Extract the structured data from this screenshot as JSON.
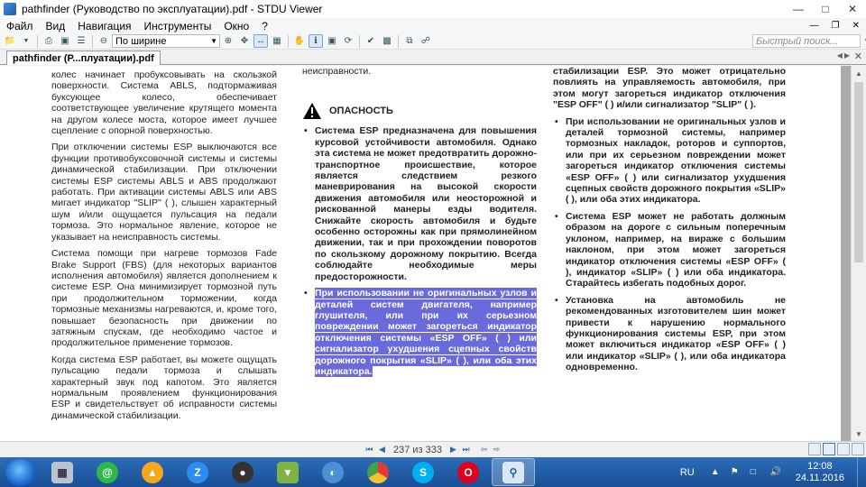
{
  "window": {
    "title": "pathfinder (Руководство по эксплуатации).pdf - STDU Viewer"
  },
  "menu": [
    "Файл",
    "Вид",
    "Навигация",
    "Инструменты",
    "Окно",
    "?"
  ],
  "toolbar": {
    "zoom_value": "По ширине",
    "search_placeholder": "Быстрый поиск..."
  },
  "tab": {
    "label": "pathfinder (P...плуатации).pdf"
  },
  "document": {
    "col1": {
      "p1": "колес начинает пробуксовывать на скользкой поверхности. Система ABLS, подтормаживая буксующее колесо, обеспечивает соответствующее увеличение крутящего момента на другом колесе моста, которое имеет лучшее сцепление с опорной поверхностью.",
      "p2": "При отключении системы ESP выключаются все функции противобуксовочной системы и системы динамической стабилизации. При отключении системы ESP системы ABLS и ABS продолжают работать. При активации системы ABLS или ABS мигает индикатор \"SLIP\" (    ), слышен характерный шум и/или ощущается пульсация на педали тормоза. Это нормальное явление, которое не указывает на неисправность системы.",
      "p3": "Система помощи при нагреве тормозов Fade Brake Support (FBS) (для некоторых вариантов исполнения автомобиля) является дополнением к системе ESP. Она минимизирует тормозной путь при продолжительном торможении, когда тормозные механизмы нагреваются, и, кроме того, повышает безопасность при движении по затяжным спускам, где необходимо частое и продолжительное применение тормозов.",
      "p4": "Когда система ESP работает, вы можете ощущать пульсацию педали тормоза и слышать характерный звук под капотом. Это является нормальным проявлением функционирования ESP и свидетельствует об исправности системы динамической стабилизации."
    },
    "col2": {
      "top": "неисправности.",
      "danger_label": "ОПАСНОСТЬ",
      "b1": "Система ESP предназначена для повышения курсовой устойчивости автомобиля. Однако эта система не может предотвратить дорожно-транспортное происшествие, которое является следствием резкого маневрирования на высокой скорости движения автомобиля или неосторожной и рискованной манеры езды водителя. Снижайте скорость автомобиля и будьте особенно осторожны как при прямолинейном движении, так и при прохождении поворотов по скользкому дорожному покрытию. Всегда соблюдайте необходимые меры предосторожности.",
      "b2": "При использовании не оригинальных узлов и деталей систем двигателя, например глушителя, или при их серьезном повреждении может загореться индикатор отключения системы «ESP OFF» (    ) или сигнализатор ухудшения сцепных свойств дорожного покрытия «SLIP» (    ), или оба этих индикатора."
    },
    "col3": {
      "top": "стабилизации ESP. Это может отрицательно повлиять на управляемость автомобиля, при этом могут загореться индикатор отключения \"ESP OFF\" (    ) и/или сигнализатор \"SLIP\" (    ).",
      "b1": "При использовании не оригинальных узлов и деталей тормозной системы, например тормозных накладок, роторов и суппортов, или при их серьезном повреждении может загореться индикатор отключения системы «ESP OFF» (    ) или сигнализатор ухудшения сцепных свойств дорожного покрытия «SLIP» (    ), или оба этих индикатора.",
      "b2": "Система ESP может не работать должным образом на дороге с сильным поперечным уклоном, например, на вираже с большим наклоном, при этом может загореться индикатор отключения системы «ESP OFF» (    ), индикатор «SLIP» (    ) или оба индикатора. Старайтесь избегать подобных дорог.",
      "b3": "Установка на автомобиль не рекомендованных изготовителем шин может привести к нарушению нормального функционирования системы ESP, при этом может включиться индикатор «ESP OFF» (    ) или индикатор «SLIP» (    ), или оба индикатора одновременно."
    }
  },
  "status": {
    "page_info": "237 из 333"
  },
  "taskbar": {
    "lang": "RU",
    "time": "12:08",
    "date": "24.11.2016",
    "colors": {
      "start": "#1b6ad0",
      "taskbar": "#1a4e93"
    }
  }
}
